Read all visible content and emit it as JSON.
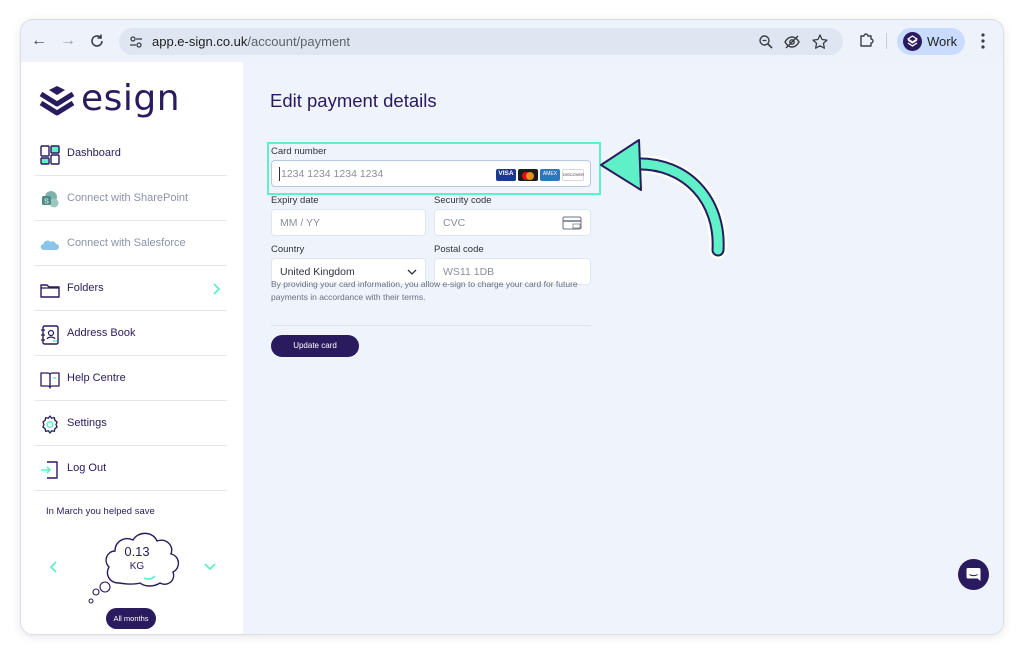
{
  "browser": {
    "url_host": "app.e-sign.co.uk",
    "url_path": "/account/payment",
    "profile_label": "Work"
  },
  "sidebar": {
    "logo_text": "esign",
    "items": [
      {
        "label": "Dashboard",
        "icon": "dashboard-icon"
      },
      {
        "label": "Connect with SharePoint",
        "icon": "sharepoint-icon"
      },
      {
        "label": "Connect with Salesforce",
        "icon": "salesforce-icon"
      },
      {
        "label": "Folders",
        "icon": "folder-icon"
      },
      {
        "label": "Address Book",
        "icon": "address-book-icon"
      },
      {
        "label": "Help Centre",
        "icon": "help-book-icon"
      },
      {
        "label": "Settings",
        "icon": "gear-icon"
      },
      {
        "label": "Log Out",
        "icon": "logout-icon"
      }
    ],
    "savings": {
      "title": "In March you helped save",
      "value": "0.13",
      "unit": "KG",
      "months_button": "All months"
    }
  },
  "form": {
    "title": "Edit payment details",
    "card_number": {
      "label": "Card number",
      "placeholder": "1234 1234 1234 1234",
      "brands": [
        "VISA",
        "Mastercard",
        "AMEX",
        "DISCOVER"
      ]
    },
    "expiry": {
      "label": "Expiry date",
      "placeholder": "MM / YY"
    },
    "security": {
      "label": "Security code",
      "placeholder": "CVC"
    },
    "country": {
      "label": "Country",
      "value": "United Kingdom"
    },
    "postal": {
      "label": "Postal code",
      "placeholder": "WS11 1DB"
    },
    "notice": "By providing your card information, you allow e-sign to charge your card for future payments in accordance with their terms.",
    "update_button": "Update card"
  },
  "colors": {
    "brand": "#2a1a5e",
    "highlight": "#5ff0c8",
    "content_bg": "#eef3fc"
  }
}
